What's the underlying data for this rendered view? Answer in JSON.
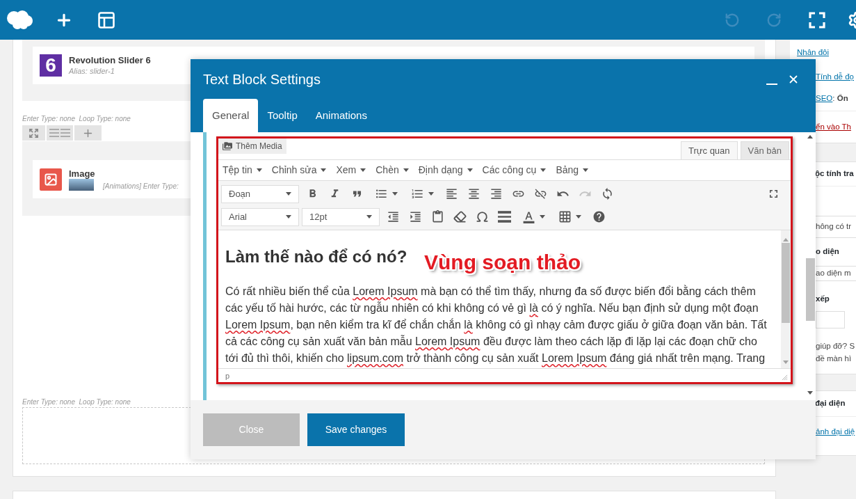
{
  "top_bar": {
    "actions": [
      {
        "kind": "undo",
        "disabled": true
      },
      {
        "kind": "redo",
        "disabled": true
      },
      {
        "kind": "fullscreen",
        "disabled": false
      },
      {
        "kind": "settings",
        "disabled": false
      }
    ]
  },
  "builder": {
    "sections": [
      {
        "element": {
          "kind": "slider",
          "badge": "6",
          "title": "Revolution Slider 6",
          "subtitle": "Alias: slider-1"
        }
      },
      {
        "meta": "Enter Type: none  Loop Type: none",
        "element": {
          "kind": "image",
          "title": "Image",
          "subtitle": "[Animations] Enter Type:"
        }
      },
      {
        "meta": "Enter Type: none  Loop Type: none"
      }
    ]
  },
  "sidebar": {
    "box_1": {
      "duplicate_link": "Nhân đôi",
      "readability_link": "Tính dễ đọ",
      "seo_link": "SEO",
      "seo_score": ": **Ổn**",
      "trash_link": "ển vào Th"
    },
    "box_2": {
      "title": "ộc tính tra",
      "parent_select": "hông có tr",
      "template_label": "o diện",
      "template_select": "ao diện m",
      "order_label": "xếp",
      "help_lines": [
        "giúp đỡ? S",
        "đề màn hì"
      ]
    },
    "box_3": {
      "title": "đại diện",
      "link": "ảnh đại diệ"
    }
  },
  "modal": {
    "title": "Text Block Settings",
    "tabs": [
      {
        "label": "General",
        "selected": true
      },
      {
        "label": "Tooltip",
        "selected": false
      },
      {
        "label": "Animations",
        "selected": false
      }
    ],
    "editor": {
      "media_button": "Thêm Media",
      "mode_tabs": [
        {
          "label": "Trực quan",
          "selected": true
        },
        {
          "label": "Văn bản",
          "selected": false
        }
      ],
      "menus": [
        "Tệp tin",
        "Chỉnh sửa",
        "Xem",
        "Chèn",
        "Định dạng",
        "Các công cụ",
        "Bảng"
      ],
      "toolbar_rows": [
        [
          {
            "kind": "select",
            "value": "Đoạn",
            "disabled": false
          },
          {
            "kind": "bold",
            "disabled": false
          },
          {
            "kind": "italic",
            "disabled": false
          },
          {
            "kind": "blockquote",
            "disabled": false
          },
          {
            "kind": "bullet_list",
            "disabled": false
          },
          {
            "kind": "numbered_list",
            "disabled": false
          },
          {
            "kind": "align_left",
            "disabled": false
          },
          {
            "kind": "align_center",
            "disabled": false
          },
          {
            "kind": "align_right",
            "disabled": false
          },
          {
            "kind": "link",
            "disabled": false
          },
          {
            "kind": "unlink",
            "disabled": false
          },
          {
            "kind": "undo",
            "disabled": false
          },
          {
            "kind": "redo",
            "disabled": true
          },
          {
            "kind": "refresh",
            "disabled": false
          },
          {
            "kind": "fullscreen",
            "disabled": false
          }
        ],
        [
          {
            "kind": "select",
            "value": "Arial",
            "disabled": false
          },
          {
            "kind": "select",
            "value": "12pt",
            "disabled": false
          },
          {
            "kind": "outdent",
            "disabled": false
          },
          {
            "kind": "indent",
            "disabled": false
          },
          {
            "kind": "paste_text",
            "disabled": false
          },
          {
            "kind": "clear_format",
            "disabled": false
          },
          {
            "kind": "special_char",
            "disabled": false
          },
          {
            "kind": "horizontal_line",
            "disabled": false
          },
          {
            "kind": "text_color",
            "disabled": false
          },
          {
            "kind": "table",
            "disabled": false
          },
          {
            "kind": "help",
            "disabled": false
          }
        ]
      ],
      "heading": "Làm thế nào để có nó?",
      "paragraph": [
        {
          "text": "Có rất nhiều biến thể của ",
          "flagged": false
        },
        {
          "text": "Lorem Ipsum",
          "flagged": true
        },
        {
          "text": " mà bạn có thể tìm thấy, nhưng đa số được biến đổi bằng cách thêm các yếu tố hài hước, các từ ngẫu nhiên có khi không có vẻ gì ",
          "flagged": false
        },
        {
          "text": "là",
          "flagged": true
        },
        {
          "text": " có ý nghĩa. Nếu bạn định sử dụng một đoạn ",
          "flagged": false
        },
        {
          "text": "Lorem Ipsum",
          "flagged": true
        },
        {
          "text": ", bạn nên kiểm tra kĩ để chắn chắn ",
          "flagged": false
        },
        {
          "text": "là",
          "flagged": true
        },
        {
          "text": " không có gì nhạy cảm được giấu ở giữa đoạn văn bản. Tất cả các công cụ sản xuất văn bản mẫu ",
          "flagged": false
        },
        {
          "text": "Lorem Ipsum",
          "flagged": true
        },
        {
          "text": " đều được làm theo cách lặp đi lặp lại các đoạn chữ cho tới đủ thì thôi, khiến cho ",
          "flagged": false
        },
        {
          "text": "lipsum.com",
          "flagged": true
        },
        {
          "text": " trở thành công cụ sản xuất ",
          "flagged": false
        },
        {
          "text": "Lorem Ipsum",
          "flagged": true
        },
        {
          "text": " đáng giá nhất trên mạng. Trang",
          "flagged": false
        }
      ],
      "status_path": "p"
    },
    "annotation": "Vùng soạn thảo",
    "buttons": [
      {
        "kind": "secondary",
        "label": "Close"
      },
      {
        "kind": "primary",
        "label": "Save changes"
      }
    ]
  }
}
